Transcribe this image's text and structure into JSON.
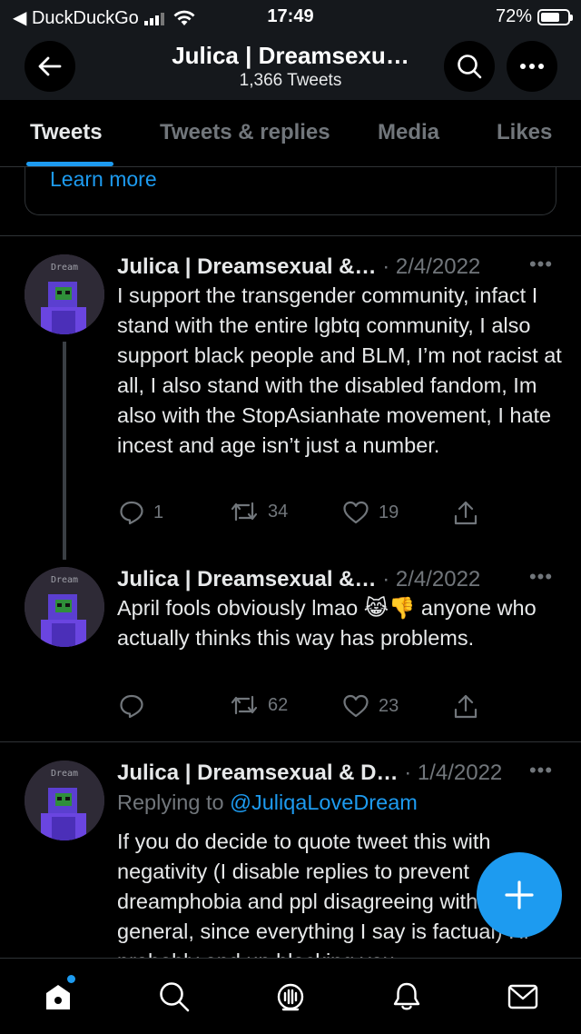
{
  "status_bar": {
    "back_app": "◀ DuckDuckGo",
    "time": "17:49",
    "battery_text": "72%",
    "battery_level": 0.72
  },
  "header": {
    "title": "Julica | Dreamsexu…",
    "subtitle": "1,366 Tweets"
  },
  "tabs": [
    {
      "label": "Tweets",
      "active": true
    },
    {
      "label": "Tweets & replies",
      "active": false
    },
    {
      "label": "Media",
      "active": false
    },
    {
      "label": "Likes",
      "active": false
    }
  ],
  "previous_card": {
    "link_text": "Learn more"
  },
  "tweets": [
    {
      "name": "Julica | Dreamsexual &…",
      "date": "· 2/4/2022",
      "more": "•••",
      "text": "I support the transgender community, infact I stand with the entire lgbtq community, I also support black people and BLM, I’m not racist at all, I also stand with the disabled fandom, Im also with the StopAsianhate movement, I hate incest and age isn’t just a number.",
      "replies": "1",
      "retweets": "34",
      "likes": "19",
      "avatar_label": "Dream"
    },
    {
      "name": "Julica | Dreamsexual &…",
      "date": "· 2/4/2022",
      "more": "•••",
      "text": "April fools obviously lmao 😹👎 anyone who actually thinks this way has problems.",
      "replies": "",
      "retweets": "62",
      "likes": "23",
      "avatar_label": "Dream"
    },
    {
      "name": "Julica | Dreamsexual & D…",
      "date": "· 1/4/2022",
      "more": "•••",
      "reply_prefix": "Replying to ",
      "reply_handle": "@JuliqaLoveDream",
      "text": "If you do decide to quote tweet this with negativity (I disable replies to prevent dreamphobia and ppl disagreeing with me in general, since everything I say is factual) I’ll probably end up blocking you",
      "avatar_label": "Dream"
    }
  ],
  "icons": {
    "back": "arrow-left-icon",
    "search": "search-icon",
    "more": "more-horizontal-icon",
    "compose": "plus-icon",
    "nav": [
      "home-icon",
      "search-icon",
      "spaces-icon",
      "notifications-icon",
      "messages-icon"
    ]
  },
  "colors": {
    "accent": "#1d9bf0",
    "background": "#000000",
    "header_bg": "#15181c",
    "muted_text": "#71767b"
  }
}
